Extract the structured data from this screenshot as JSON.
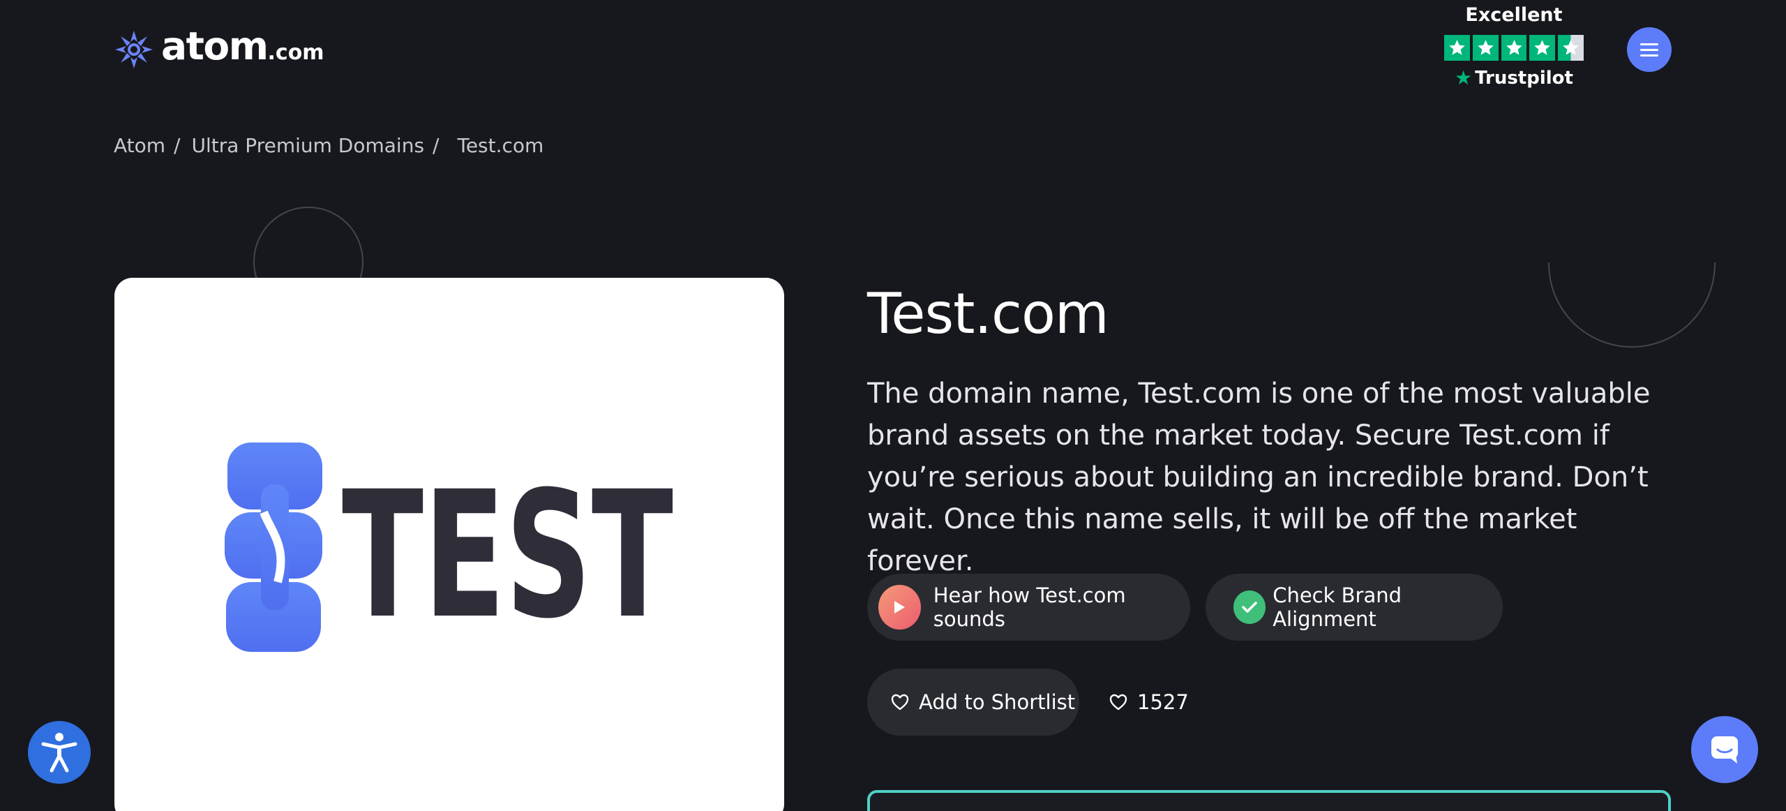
{
  "header": {
    "logo_text": "atom",
    "logo_tld": ".com",
    "trustpilot": {
      "rating_label": "Excellent",
      "stars": 4.5,
      "brand": "Trustpilot",
      "star_color": "#00b67a"
    },
    "menu_icon": "hamburger-icon"
  },
  "breadcrumb": {
    "items": [
      "Atom",
      "Ultra Premium Domains"
    ],
    "separator": "/",
    "current": "Test.com"
  },
  "domain": {
    "title": "Test.com",
    "description": "The domain name, Test.com is one of the most valuable brand assets on the market today. Secure Test.com if you’re serious about building an incredible brand. Don’t wait. Once this name sells, it will be off the market forever.",
    "logo_text": "TEST"
  },
  "actions": {
    "hear_sound_label": "Hear how Test.com sounds",
    "brand_alignment_label": "Check Brand Alignment",
    "shortlist_label": "Add to Shortlist",
    "likes_count": "1527"
  },
  "colors": {
    "background": "#17181d",
    "accent": "#5c7cfa",
    "pill_bg": "#2a2b31",
    "teal_border": "#4fd1c5"
  },
  "floating": {
    "accessibility_icon": "accessibility-icon",
    "chat_icon": "chat-icon"
  }
}
